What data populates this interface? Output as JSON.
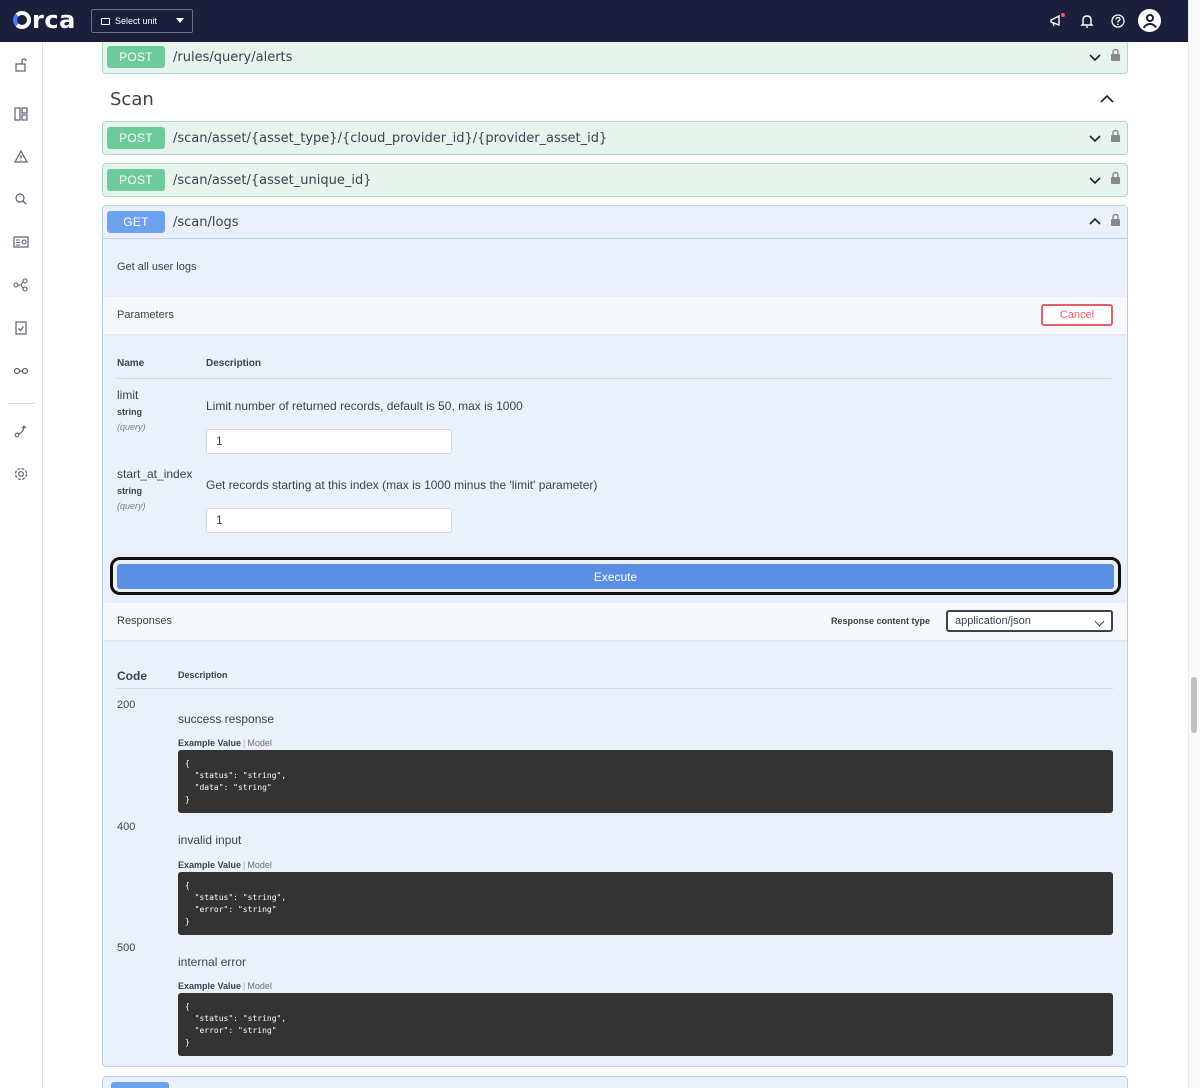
{
  "app": {
    "logo_text": "orca",
    "unit_select": "Select unit"
  },
  "sidebar": {
    "icons": [
      "unlock-icon",
      "dashboard-icon",
      "alert-icon",
      "search-icon",
      "inventory-icon",
      "graph-icon",
      "compliance-icon",
      "shift-left-icon",
      "integration-icon",
      "settings-icon"
    ]
  },
  "endpoints": {
    "top": {
      "method": "POST",
      "path": "/rules/query/alerts"
    },
    "section_title": "Scan",
    "scan_items": [
      {
        "method": "POST",
        "path": "/scan/asset/{asset_type}/{cloud_provider_id}/{provider_asset_id}"
      },
      {
        "method": "POST",
        "path": "/scan/asset/{asset_unique_id}"
      }
    ],
    "get": {
      "method": "GET",
      "path": "/scan/logs",
      "description": "Get all user logs"
    }
  },
  "parameters": {
    "label": "Parameters",
    "cancel": "Cancel",
    "col_name": "Name",
    "col_desc": "Description",
    "items": [
      {
        "name": "limit",
        "type": "string",
        "in": "(query)",
        "description": "Limit number of returned records, default is 50, max is 1000",
        "value": "1"
      },
      {
        "name": "start_at_index",
        "type": "string",
        "in": "(query)",
        "description": "Get records starting at this index (max is 1000 minus the 'limit' parameter)",
        "value": "1"
      }
    ]
  },
  "execute": "Execute",
  "responses": {
    "label": "Responses",
    "content_type_label": "Response content type",
    "content_type": "application/json",
    "col_code": "Code",
    "col_desc": "Description",
    "example_value": "Example Value",
    "model": "Model",
    "items": [
      {
        "code": "200",
        "description": "success response",
        "example": "{\n  \"status\": \"string\",\n  \"data\": \"string\"\n}"
      },
      {
        "code": "400",
        "description": "invalid input",
        "example": "{\n  \"status\": \"string\",\n  \"error\": \"string\"\n}"
      },
      {
        "code": "500",
        "description": "internal error",
        "example": "{\n  \"status\": \"string\",\n  \"error\": \"string\"\n}"
      }
    ]
  },
  "colors": {
    "post": "#6dcb99",
    "get": "#6ea1f0",
    "topbar": "#1b1f3b",
    "cancel": "#e2606a",
    "execute": "#5b8fe4"
  }
}
